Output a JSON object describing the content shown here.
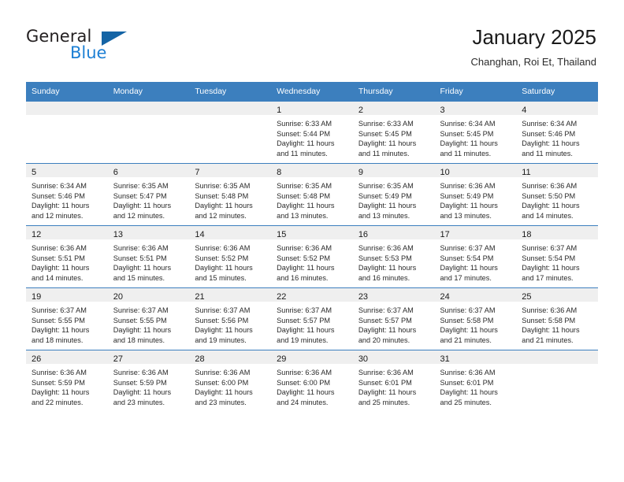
{
  "brand": {
    "name_part1": "General",
    "name_part2": "Blue",
    "flag_icon": "triangle-flag-icon"
  },
  "header": {
    "title": "January 2025",
    "subtitle": "Changhan, Roi Et, Thailand"
  },
  "colors": {
    "header_blue": "#3c7fbe",
    "brand_blue": "#1c7fd4",
    "flag_blue": "#1464a5",
    "cell_head_gray": "#efefef"
  },
  "weekday_headers": [
    "Sunday",
    "Monday",
    "Tuesday",
    "Wednesday",
    "Thursday",
    "Friday",
    "Saturday"
  ],
  "weeks": [
    [
      {
        "day": "",
        "sunrise": "",
        "sunset": "",
        "daylight_line1": "",
        "daylight_line2": ""
      },
      {
        "day": "",
        "sunrise": "",
        "sunset": "",
        "daylight_line1": "",
        "daylight_line2": ""
      },
      {
        "day": "",
        "sunrise": "",
        "sunset": "",
        "daylight_line1": "",
        "daylight_line2": ""
      },
      {
        "day": "1",
        "sunrise": "Sunrise: 6:33 AM",
        "sunset": "Sunset: 5:44 PM",
        "daylight_line1": "Daylight: 11 hours",
        "daylight_line2": "and 11 minutes."
      },
      {
        "day": "2",
        "sunrise": "Sunrise: 6:33 AM",
        "sunset": "Sunset: 5:45 PM",
        "daylight_line1": "Daylight: 11 hours",
        "daylight_line2": "and 11 minutes."
      },
      {
        "day": "3",
        "sunrise": "Sunrise: 6:34 AM",
        "sunset": "Sunset: 5:45 PM",
        "daylight_line1": "Daylight: 11 hours",
        "daylight_line2": "and 11 minutes."
      },
      {
        "day": "4",
        "sunrise": "Sunrise: 6:34 AM",
        "sunset": "Sunset: 5:46 PM",
        "daylight_line1": "Daylight: 11 hours",
        "daylight_line2": "and 11 minutes."
      }
    ],
    [
      {
        "day": "5",
        "sunrise": "Sunrise: 6:34 AM",
        "sunset": "Sunset: 5:46 PM",
        "daylight_line1": "Daylight: 11 hours",
        "daylight_line2": "and 12 minutes."
      },
      {
        "day": "6",
        "sunrise": "Sunrise: 6:35 AM",
        "sunset": "Sunset: 5:47 PM",
        "daylight_line1": "Daylight: 11 hours",
        "daylight_line2": "and 12 minutes."
      },
      {
        "day": "7",
        "sunrise": "Sunrise: 6:35 AM",
        "sunset": "Sunset: 5:48 PM",
        "daylight_line1": "Daylight: 11 hours",
        "daylight_line2": "and 12 minutes."
      },
      {
        "day": "8",
        "sunrise": "Sunrise: 6:35 AM",
        "sunset": "Sunset: 5:48 PM",
        "daylight_line1": "Daylight: 11 hours",
        "daylight_line2": "and 13 minutes."
      },
      {
        "day": "9",
        "sunrise": "Sunrise: 6:35 AM",
        "sunset": "Sunset: 5:49 PM",
        "daylight_line1": "Daylight: 11 hours",
        "daylight_line2": "and 13 minutes."
      },
      {
        "day": "10",
        "sunrise": "Sunrise: 6:36 AM",
        "sunset": "Sunset: 5:49 PM",
        "daylight_line1": "Daylight: 11 hours",
        "daylight_line2": "and 13 minutes."
      },
      {
        "day": "11",
        "sunrise": "Sunrise: 6:36 AM",
        "sunset": "Sunset: 5:50 PM",
        "daylight_line1": "Daylight: 11 hours",
        "daylight_line2": "and 14 minutes."
      }
    ],
    [
      {
        "day": "12",
        "sunrise": "Sunrise: 6:36 AM",
        "sunset": "Sunset: 5:51 PM",
        "daylight_line1": "Daylight: 11 hours",
        "daylight_line2": "and 14 minutes."
      },
      {
        "day": "13",
        "sunrise": "Sunrise: 6:36 AM",
        "sunset": "Sunset: 5:51 PM",
        "daylight_line1": "Daylight: 11 hours",
        "daylight_line2": "and 15 minutes."
      },
      {
        "day": "14",
        "sunrise": "Sunrise: 6:36 AM",
        "sunset": "Sunset: 5:52 PM",
        "daylight_line1": "Daylight: 11 hours",
        "daylight_line2": "and 15 minutes."
      },
      {
        "day": "15",
        "sunrise": "Sunrise: 6:36 AM",
        "sunset": "Sunset: 5:52 PM",
        "daylight_line1": "Daylight: 11 hours",
        "daylight_line2": "and 16 minutes."
      },
      {
        "day": "16",
        "sunrise": "Sunrise: 6:36 AM",
        "sunset": "Sunset: 5:53 PM",
        "daylight_line1": "Daylight: 11 hours",
        "daylight_line2": "and 16 minutes."
      },
      {
        "day": "17",
        "sunrise": "Sunrise: 6:37 AM",
        "sunset": "Sunset: 5:54 PM",
        "daylight_line1": "Daylight: 11 hours",
        "daylight_line2": "and 17 minutes."
      },
      {
        "day": "18",
        "sunrise": "Sunrise: 6:37 AM",
        "sunset": "Sunset: 5:54 PM",
        "daylight_line1": "Daylight: 11 hours",
        "daylight_line2": "and 17 minutes."
      }
    ],
    [
      {
        "day": "19",
        "sunrise": "Sunrise: 6:37 AM",
        "sunset": "Sunset: 5:55 PM",
        "daylight_line1": "Daylight: 11 hours",
        "daylight_line2": "and 18 minutes."
      },
      {
        "day": "20",
        "sunrise": "Sunrise: 6:37 AM",
        "sunset": "Sunset: 5:55 PM",
        "daylight_line1": "Daylight: 11 hours",
        "daylight_line2": "and 18 minutes."
      },
      {
        "day": "21",
        "sunrise": "Sunrise: 6:37 AM",
        "sunset": "Sunset: 5:56 PM",
        "daylight_line1": "Daylight: 11 hours",
        "daylight_line2": "and 19 minutes."
      },
      {
        "day": "22",
        "sunrise": "Sunrise: 6:37 AM",
        "sunset": "Sunset: 5:57 PM",
        "daylight_line1": "Daylight: 11 hours",
        "daylight_line2": "and 19 minutes."
      },
      {
        "day": "23",
        "sunrise": "Sunrise: 6:37 AM",
        "sunset": "Sunset: 5:57 PM",
        "daylight_line1": "Daylight: 11 hours",
        "daylight_line2": "and 20 minutes."
      },
      {
        "day": "24",
        "sunrise": "Sunrise: 6:37 AM",
        "sunset": "Sunset: 5:58 PM",
        "daylight_line1": "Daylight: 11 hours",
        "daylight_line2": "and 21 minutes."
      },
      {
        "day": "25",
        "sunrise": "Sunrise: 6:36 AM",
        "sunset": "Sunset: 5:58 PM",
        "daylight_line1": "Daylight: 11 hours",
        "daylight_line2": "and 21 minutes."
      }
    ],
    [
      {
        "day": "26",
        "sunrise": "Sunrise: 6:36 AM",
        "sunset": "Sunset: 5:59 PM",
        "daylight_line1": "Daylight: 11 hours",
        "daylight_line2": "and 22 minutes."
      },
      {
        "day": "27",
        "sunrise": "Sunrise: 6:36 AM",
        "sunset": "Sunset: 5:59 PM",
        "daylight_line1": "Daylight: 11 hours",
        "daylight_line2": "and 23 minutes."
      },
      {
        "day": "28",
        "sunrise": "Sunrise: 6:36 AM",
        "sunset": "Sunset: 6:00 PM",
        "daylight_line1": "Daylight: 11 hours",
        "daylight_line2": "and 23 minutes."
      },
      {
        "day": "29",
        "sunrise": "Sunrise: 6:36 AM",
        "sunset": "Sunset: 6:00 PM",
        "daylight_line1": "Daylight: 11 hours",
        "daylight_line2": "and 24 minutes."
      },
      {
        "day": "30",
        "sunrise": "Sunrise: 6:36 AM",
        "sunset": "Sunset: 6:01 PM",
        "daylight_line1": "Daylight: 11 hours",
        "daylight_line2": "and 25 minutes."
      },
      {
        "day": "31",
        "sunrise": "Sunrise: 6:36 AM",
        "sunset": "Sunset: 6:01 PM",
        "daylight_line1": "Daylight: 11 hours",
        "daylight_line2": "and 25 minutes."
      },
      {
        "day": "",
        "sunrise": "",
        "sunset": "",
        "daylight_line1": "",
        "daylight_line2": ""
      }
    ]
  ]
}
